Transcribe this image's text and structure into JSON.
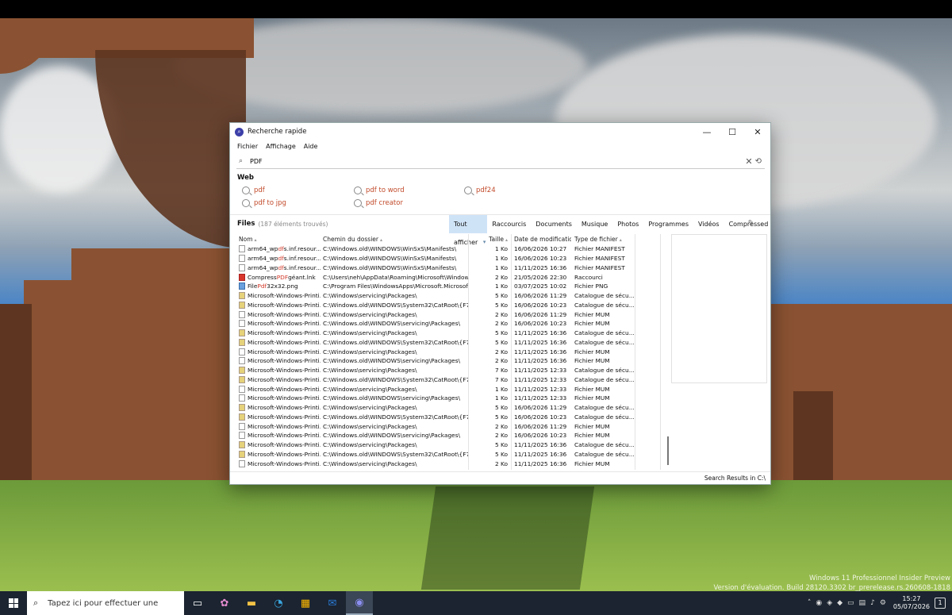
{
  "window": {
    "title": "Recherche rapide",
    "app_icon": "search-app-icon",
    "controls": {
      "minimize": "—",
      "maximize": "☐",
      "close": "✕"
    }
  },
  "menu": [
    "Fichier",
    "Affichage",
    "Aide"
  ],
  "search": {
    "value": "PDF",
    "clear": "✕",
    "history": "⟲"
  },
  "web": {
    "title": "Web",
    "links": [
      "pdf",
      "pdf to word",
      "pdf24",
      "pdf to jpg",
      "pdf creator"
    ]
  },
  "files": {
    "title": "Files",
    "count": "(187 éléments trouvés)",
    "tabs": [
      "Tout afficher",
      "Raccourcis",
      "Documents",
      "Musique",
      "Photos",
      "Programmes",
      "Vidéos",
      "Compressed"
    ],
    "active_tab": "Tout afficher",
    "columns": [
      "Nom",
      "Chemin du dossier",
      "Taille",
      "Date de modification",
      "Type de fichier"
    ],
    "rows": [
      {
        "icon": "doc",
        "name": [
          "arm64_wp",
          "df",
          "s.inf.resour..."
        ],
        "path": "C:\\Windows.old\\WINDOWS\\WinSxS\\Manifests\\",
        "size": "1 Ko",
        "date": "16/06/2026 10:27",
        "type": "Fichier MANIFEST"
      },
      {
        "icon": "doc",
        "name": [
          "arm64_wp",
          "df",
          "s.inf.resour..."
        ],
        "path": "C:\\Windows.old\\WINDOWS\\WinSxS\\Manifests\\",
        "size": "1 Ko",
        "date": "16/06/2026 10:23",
        "type": "Fichier MANIFEST"
      },
      {
        "icon": "doc",
        "name": [
          "arm64_wp",
          "df",
          "s.inf.resour..."
        ],
        "path": "C:\\Windows.old\\WINDOWS\\WinSxS\\Manifests\\",
        "size": "1 Ko",
        "date": "11/11/2025 16:36",
        "type": "Fichier MANIFEST"
      },
      {
        "icon": "pdf",
        "name": [
          "Compress ",
          "PDF",
          " géant.lnk"
        ],
        "path": "C:\\Users\\neh\\AppData\\Roaming\\Microsoft\\Windows...",
        "size": "2 Ko",
        "date": "21/05/2026 22:30",
        "type": "Raccourci"
      },
      {
        "icon": "png",
        "name": [
          "File",
          "Pdf",
          "32x32.png"
        ],
        "path": "C:\\Program Files\\WindowsApps\\Microsoft.Microsoft....",
        "size": "1 Ko",
        "date": "03/07/2025 10:02",
        "type": "Fichier PNG"
      },
      {
        "icon": "cat",
        "name": [
          "Microsoft-Windows-Printi...",
          "",
          ""
        ],
        "path": "C:\\Windows\\servicing\\Packages\\",
        "size": "5 Ko",
        "date": "16/06/2026 11:29",
        "type": "Catalogue de sécu..."
      },
      {
        "icon": "cat",
        "name": [
          "Microsoft-Windows-Printi...",
          "",
          ""
        ],
        "path": "C:\\Windows.old\\WINDOWS\\System32\\CatRoot\\{F7...",
        "size": "5 Ko",
        "date": "16/06/2026 10:23",
        "type": "Catalogue de sécu..."
      },
      {
        "icon": "doc",
        "name": [
          "Microsoft-Windows-Printi...",
          "",
          ""
        ],
        "path": "C:\\Windows\\servicing\\Packages\\",
        "size": "2 Ko",
        "date": "16/06/2026 11:29",
        "type": "Fichier MUM"
      },
      {
        "icon": "doc",
        "name": [
          "Microsoft-Windows-Printi...",
          "",
          ""
        ],
        "path": "C:\\Windows.old\\WINDOWS\\servicing\\Packages\\",
        "size": "2 Ko",
        "date": "16/06/2026 10:23",
        "type": "Fichier MUM"
      },
      {
        "icon": "cat",
        "name": [
          "Microsoft-Windows-Printi...",
          "",
          ""
        ],
        "path": "C:\\Windows\\servicing\\Packages\\",
        "size": "5 Ko",
        "date": "11/11/2025 16:36",
        "type": "Catalogue de sécu..."
      },
      {
        "icon": "cat",
        "name": [
          "Microsoft-Windows-Printi...",
          "",
          ""
        ],
        "path": "C:\\Windows.old\\WINDOWS\\System32\\CatRoot\\{F7...",
        "size": "5 Ko",
        "date": "11/11/2025 16:36",
        "type": "Catalogue de sécu..."
      },
      {
        "icon": "doc",
        "name": [
          "Microsoft-Windows-Printi...",
          "",
          ""
        ],
        "path": "C:\\Windows\\servicing\\Packages\\",
        "size": "2 Ko",
        "date": "11/11/2025 16:36",
        "type": "Fichier MUM"
      },
      {
        "icon": "doc",
        "name": [
          "Microsoft-Windows-Printi...",
          "",
          ""
        ],
        "path": "C:\\Windows.old\\WINDOWS\\servicing\\Packages\\",
        "size": "2 Ko",
        "date": "11/11/2025 16:36",
        "type": "Fichier MUM"
      },
      {
        "icon": "cat",
        "name": [
          "Microsoft-Windows-Printi...",
          "",
          ""
        ],
        "path": "C:\\Windows\\servicing\\Packages\\",
        "size": "7 Ko",
        "date": "11/11/2025 12:33",
        "type": "Catalogue de sécu..."
      },
      {
        "icon": "cat",
        "name": [
          "Microsoft-Windows-Printi...",
          "",
          ""
        ],
        "path": "C:\\Windows.old\\WINDOWS\\System32\\CatRoot\\{F7...",
        "size": "7 Ko",
        "date": "11/11/2025 12:33",
        "type": "Catalogue de sécu..."
      },
      {
        "icon": "doc",
        "name": [
          "Microsoft-Windows-Printi...",
          "",
          ""
        ],
        "path": "C:\\Windows\\servicing\\Packages\\",
        "size": "1 Ko",
        "date": "11/11/2025 12:33",
        "type": "Fichier MUM"
      },
      {
        "icon": "doc",
        "name": [
          "Microsoft-Windows-Printi...",
          "",
          ""
        ],
        "path": "C:\\Windows.old\\WINDOWS\\servicing\\Packages\\",
        "size": "1 Ko",
        "date": "11/11/2025 12:33",
        "type": "Fichier MUM"
      },
      {
        "icon": "cat",
        "name": [
          "Microsoft-Windows-Printi...",
          "",
          ""
        ],
        "path": "C:\\Windows\\servicing\\Packages\\",
        "size": "5 Ko",
        "date": "16/06/2026 11:29",
        "type": "Catalogue de sécu..."
      },
      {
        "icon": "cat",
        "name": [
          "Microsoft-Windows-Printi...",
          "",
          ""
        ],
        "path": "C:\\Windows.old\\WINDOWS\\System32\\CatRoot\\{F7...",
        "size": "5 Ko",
        "date": "16/06/2026 10:23",
        "type": "Catalogue de sécu..."
      },
      {
        "icon": "doc",
        "name": [
          "Microsoft-Windows-Printi...",
          "",
          ""
        ],
        "path": "C:\\Windows\\servicing\\Packages\\",
        "size": "2 Ko",
        "date": "16/06/2026 11:29",
        "type": "Fichier MUM"
      },
      {
        "icon": "doc",
        "name": [
          "Microsoft-Windows-Printi...",
          "",
          ""
        ],
        "path": "C:\\Windows.old\\WINDOWS\\servicing\\Packages\\",
        "size": "2 Ko",
        "date": "16/06/2026 10:23",
        "type": "Fichier MUM"
      },
      {
        "icon": "cat",
        "name": [
          "Microsoft-Windows-Printi...",
          "",
          ""
        ],
        "path": "C:\\Windows\\servicing\\Packages\\",
        "size": "5 Ko",
        "date": "11/11/2025 16:36",
        "type": "Catalogue de sécu..."
      },
      {
        "icon": "cat",
        "name": [
          "Microsoft-Windows-Printi...",
          "",
          ""
        ],
        "path": "C:\\Windows.old\\WINDOWS\\System32\\CatRoot\\{F7...",
        "size": "5 Ko",
        "date": "11/11/2025 16:36",
        "type": "Catalogue de sécu..."
      },
      {
        "icon": "doc",
        "name": [
          "Microsoft-Windows-Printi...",
          "",
          ""
        ],
        "path": "C:\\Windows\\servicing\\Packages\\",
        "size": "2 Ko",
        "date": "11/11/2025 16:36",
        "type": "Fichier MUM"
      }
    ]
  },
  "status": "Search Results in C:\\",
  "desktop": {
    "watermark_line1": "Windows 11 Professionnel Insider Preview",
    "watermark_line2": "Version d'évaluation. Build 28120.3302 br_prerelease.rs.260608-1818"
  },
  "taskbar": {
    "search_placeholder": "Tapez ici pour effectuer une",
    "apps": [
      "task-view-icon",
      "copilot-icon",
      "file-explorer-icon",
      "edge-icon",
      "store-icon",
      "outlook-icon",
      "search-app-icon"
    ],
    "time": "15:27",
    "date": "05/07/2026",
    "notifications": "1"
  },
  "colors": {
    "accent": "#cfe3f7",
    "highlight": "#d23a2a",
    "taskbar": "#1b2430"
  }
}
